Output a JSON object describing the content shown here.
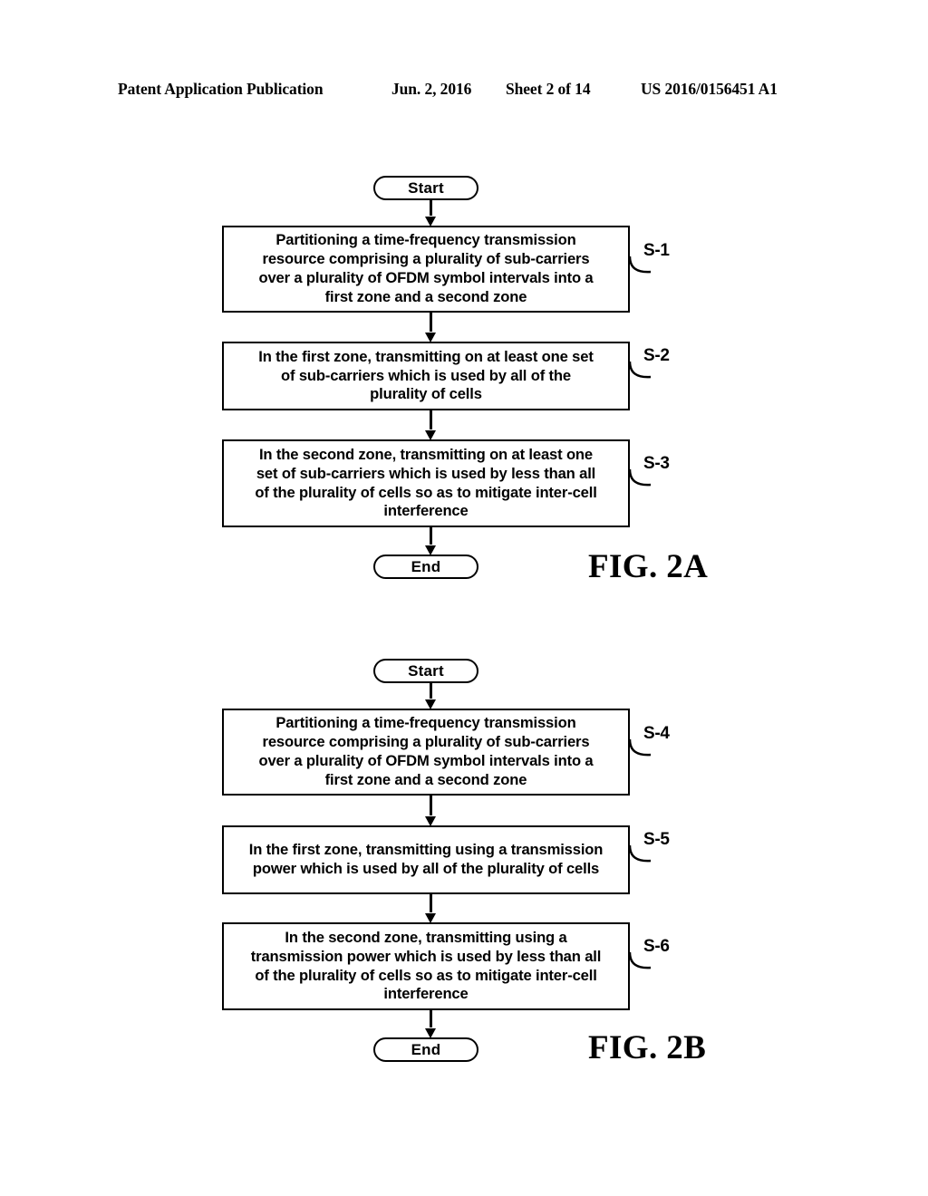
{
  "header": {
    "publication": "Patent Application Publication",
    "date": "Jun. 2, 2016",
    "sheet": "Sheet 2 of 14",
    "number": "US 2016/0156451 A1"
  },
  "figures": [
    {
      "id": "2a",
      "caption": "FIG. 2A",
      "start_label": "Start",
      "end_label": "End",
      "steps": [
        {
          "ref": "S-1",
          "text": "Partitioning a time-frequency transmission\nresource comprising a plurality of sub-carriers\nover a plurality of OFDM symbol intervals into a\nfirst zone and a second zone"
        },
        {
          "ref": "S-2",
          "text": "In the first zone, transmitting on at least one set\nof sub-carriers which is used by all of the\nplurality of cells"
        },
        {
          "ref": "S-3",
          "text": "In the second zone, transmitting on at least one\nset of sub-carriers which is used by less than all\nof the plurality of cells so as to mitigate inter-cell\ninterference"
        }
      ]
    },
    {
      "id": "2b",
      "caption": "FIG. 2B",
      "start_label": "Start",
      "end_label": "End",
      "steps": [
        {
          "ref": "S-4",
          "text": "Partitioning a time-frequency transmission\nresource comprising a plurality of sub-carriers\nover a plurality of OFDM symbol intervals into a\nfirst zone and a second zone"
        },
        {
          "ref": "S-5",
          "text": "In the first zone, transmitting using a transmission\npower which is used by all of the plurality of cells"
        },
        {
          "ref": "S-6",
          "text": "In the second zone, transmitting using a\ntransmission power which is used by less than all\nof the plurality of cells so as to mitigate inter-cell\ninterference"
        }
      ]
    }
  ],
  "colors": {
    "ink": "#000000",
    "paper": "#ffffff"
  }
}
